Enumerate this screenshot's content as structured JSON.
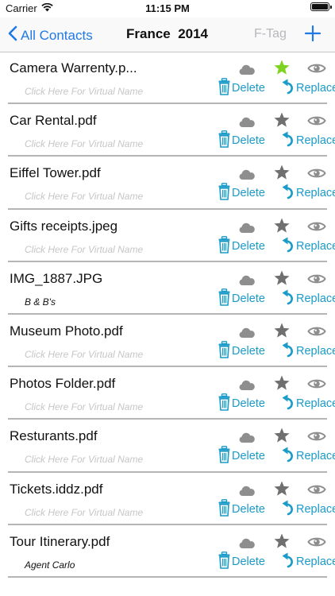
{
  "status_bar": {
    "carrier": "Carrier",
    "time": "11:15 PM",
    "battery_level": 1.0
  },
  "nav": {
    "back_label": "All Contacts",
    "title": "France  2014",
    "ftag_label": "F-Tag",
    "add_icon": "plus-icon"
  },
  "actions": {
    "delete_label": "Delete",
    "replace_label": "Replace"
  },
  "colors": {
    "accent": "#1f7ae6",
    "action": "#1a9bc8",
    "star_active": "#7ed321",
    "star_inactive": "#6f6f6f",
    "icon_gray": "#8e8e8e",
    "placeholder": "#c6c6c6"
  },
  "files": [
    {
      "name": "Camera Warrenty.p...",
      "virtual_name": "",
      "placeholder": "Click Here For Virtual Name",
      "starred": true
    },
    {
      "name": "Car Rental.pdf",
      "virtual_name": "",
      "placeholder": "Click Here For Virtual Name",
      "starred": false
    },
    {
      "name": "Eiffel Tower.pdf",
      "virtual_name": "",
      "placeholder": "Click Here For Virtual Name",
      "starred": false
    },
    {
      "name": "Gifts receipts.jpeg",
      "virtual_name": "",
      "placeholder": "Click Here For Virtual Name",
      "starred": false
    },
    {
      "name": "IMG_1887.JPG",
      "virtual_name": "B & B's",
      "placeholder": "Click Here For Virtual Name",
      "starred": false
    },
    {
      "name": "Museum Photo.pdf",
      "virtual_name": "",
      "placeholder": "Click Here For Virtual Name",
      "starred": false
    },
    {
      "name": "Photos Folder.pdf",
      "virtual_name": "",
      "placeholder": "Click Here For Virtual Name",
      "starred": false
    },
    {
      "name": "Resturants.pdf",
      "virtual_name": "",
      "placeholder": "Click Here For Virtual Name",
      "starred": false
    },
    {
      "name": "Tickets.iddz.pdf",
      "virtual_name": "",
      "placeholder": "Click Here For Virtual Name",
      "starred": false
    },
    {
      "name": "Tour Itinerary.pdf",
      "virtual_name": "Agent Carlo",
      "placeholder": "Click Here For Virtual Name",
      "starred": false
    }
  ]
}
